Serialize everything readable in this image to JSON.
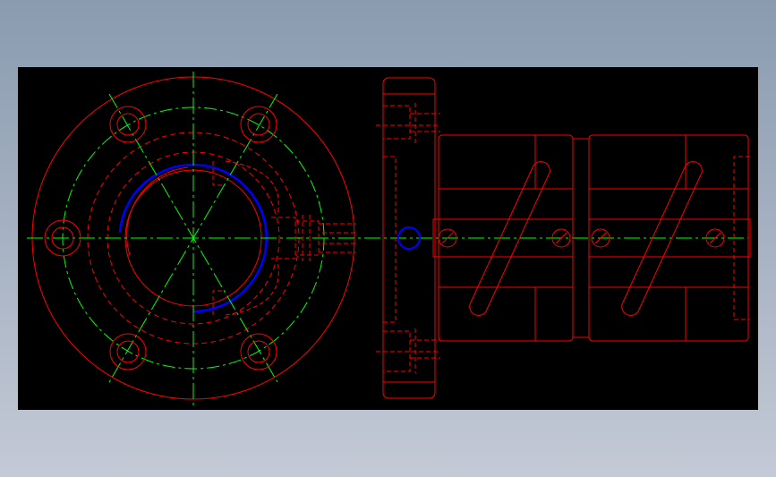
{
  "drawing": {
    "background": "#000000",
    "page_background": "#a9b4c4",
    "colors": {
      "outline": "#ff0000",
      "centerline": "#00ff00",
      "thread": "#0000ff"
    },
    "views": [
      {
        "name": "front-view",
        "description_icon": "flange-circle-icon"
      },
      {
        "name": "side-view",
        "description_icon": "nut-section-icon"
      }
    ]
  }
}
